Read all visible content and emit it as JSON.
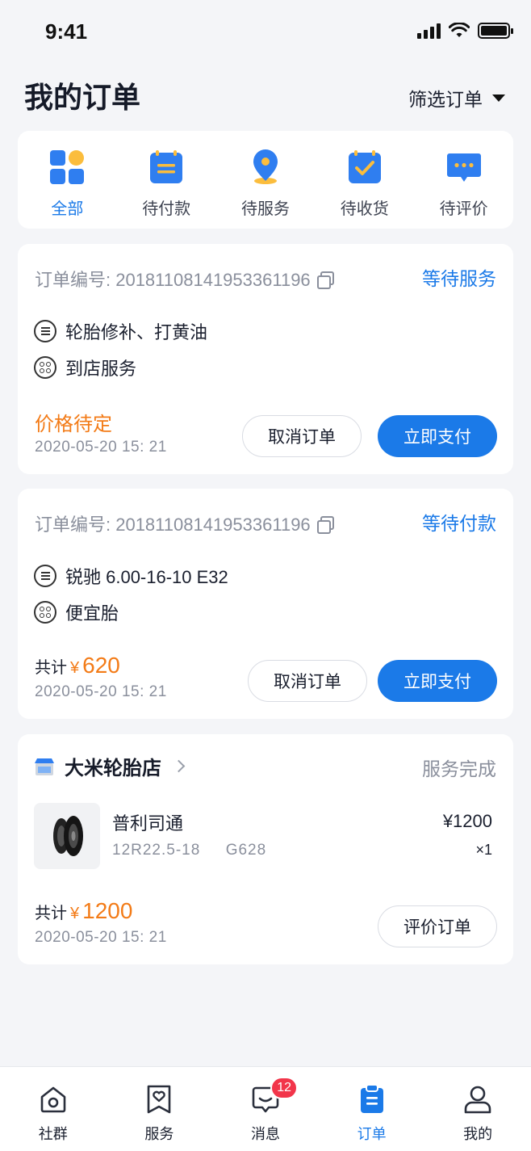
{
  "status_bar": {
    "time": "9:41"
  },
  "header": {
    "title": "我的订单",
    "filter_label": "筛选订单"
  },
  "categories": [
    {
      "label": "全部",
      "icon": "all-orders-icon",
      "active": true
    },
    {
      "label": "待付款",
      "icon": "pending-payment-icon"
    },
    {
      "label": "待服务",
      "icon": "pending-service-icon"
    },
    {
      "label": "待收货",
      "icon": "pending-receipt-icon"
    },
    {
      "label": "待评价",
      "icon": "pending-review-icon"
    }
  ],
  "orders": [
    {
      "order_no": "订单编号: 20181108141953361196",
      "status": "等待服务",
      "item": "轮胎修补、打黄油",
      "service": "到店服务",
      "price_text": "价格待定",
      "time": "2020-05-20  15: 21",
      "cancel_label": "取消订单",
      "pay_label": "立即支付"
    },
    {
      "order_no": "订单编号: 20181108141953361196",
      "status": "等待付款",
      "item": "锐驰  6.00-16-10  E32",
      "service": "便宜胎",
      "total_label": "共计",
      "currency": "¥",
      "total_value": "620",
      "time": "2020-05-20  15: 21",
      "cancel_label": "取消订单",
      "pay_label": "立即支付"
    },
    {
      "shop_name": "大米轮胎店",
      "status": "服务完成",
      "product_name": "普利司通",
      "product_spec": "12R22.5-18     G628",
      "product_price": "¥1200",
      "product_qty": "×1",
      "total_label": "共计",
      "currency": "¥",
      "total_value": "1200",
      "time": "2020-05-20  15: 21",
      "review_label": "评价订单"
    }
  ],
  "tabbar": [
    {
      "label": "社群",
      "icon": "community-icon"
    },
    {
      "label": "服务",
      "icon": "service-icon"
    },
    {
      "label": "消息",
      "icon": "message-icon",
      "badge": "12"
    },
    {
      "label": "订单",
      "icon": "orders-icon",
      "active": true
    },
    {
      "label": "我的",
      "icon": "profile-icon"
    }
  ],
  "colors": {
    "primary": "#1b7ae8",
    "accent": "#f37b17",
    "badge": "#f2354a"
  }
}
